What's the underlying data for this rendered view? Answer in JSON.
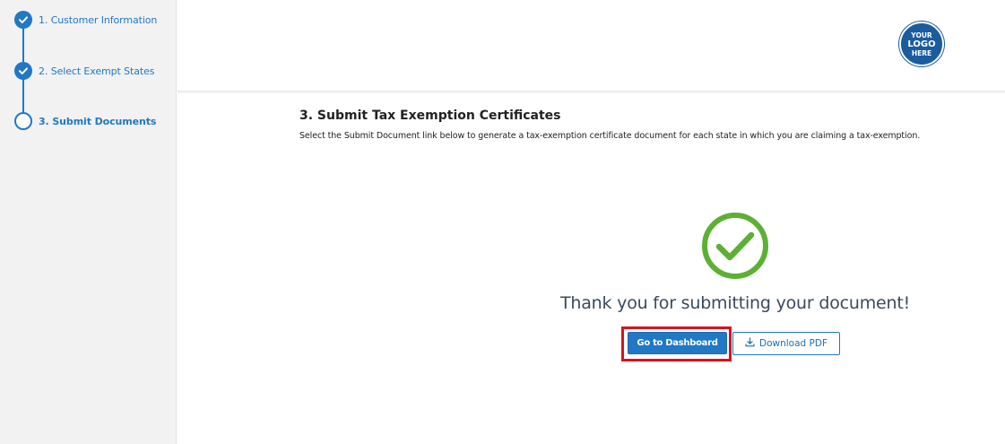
{
  "sidebar": {
    "steps": [
      {
        "label": "1. Customer Information",
        "state": "complete"
      },
      {
        "label": "2. Select Exempt States",
        "state": "complete"
      },
      {
        "label": "3. Submit Documents",
        "state": "current"
      }
    ]
  },
  "logo": {
    "line1": "YOUR",
    "line2": "LOGO",
    "line3": "HERE"
  },
  "main": {
    "title": "3. Submit Tax Exemption Certificates",
    "description": "Select the Submit Document link below to generate a tax-exemption certificate document for each state in which you are claiming a tax-exemption.",
    "success_icon": "check-circle-icon",
    "thank_you": "Thank you for submitting your document!",
    "dashboard_button": "Go to Dashboard",
    "download_button": "Download PDF",
    "download_icon": "download-icon"
  },
  "colors": {
    "accent": "#2178c4",
    "success": "#5cb033",
    "highlight": "#d9121d",
    "sidebar_bg": "#f2f2f2"
  }
}
